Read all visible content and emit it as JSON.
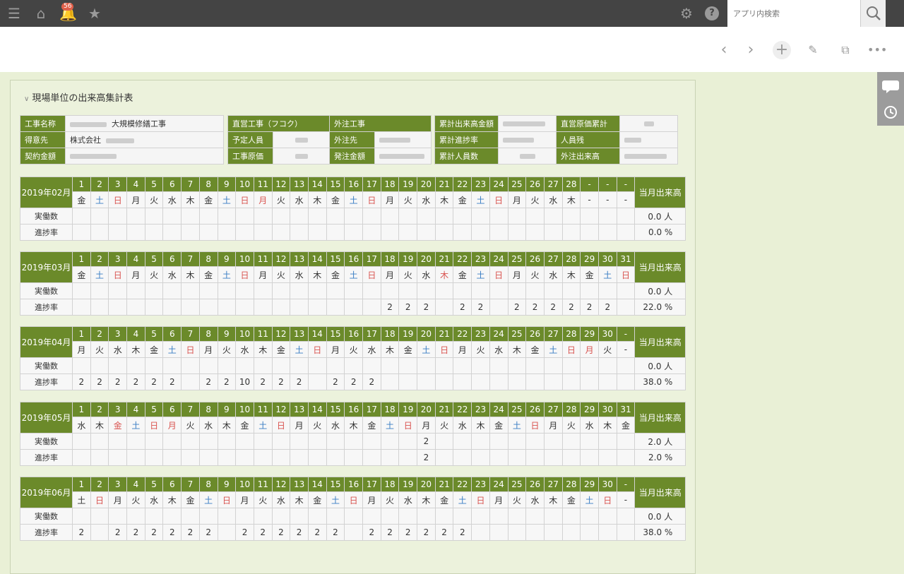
{
  "topbar": {
    "badge_count": "56",
    "search_placeholder": "アプリ内検索"
  },
  "section_title": "現場単位の出来高集計表",
  "info": {
    "block1": [
      {
        "label": "工事名称",
        "value": "大規模修繕工事",
        "blurred_prefix": true
      },
      {
        "label": "得意先",
        "value": "株式会社",
        "blurred_suffix": true
      },
      {
        "label": "契約金額",
        "value": "",
        "blurred": true
      }
    ],
    "block2": {
      "header_left": "直営工事（フコク）",
      "header_right": "外注工事",
      "rows": [
        {
          "l1": "予定人員",
          "l2": "外注先"
        },
        {
          "l1": "工事原価",
          "l2": "発注金額"
        }
      ]
    },
    "block3": [
      {
        "label": "累計出来高金額",
        "label2": "直営原価累計"
      },
      {
        "label": "累計進捗率",
        "label2": "人員残"
      },
      {
        "label": "累計人員数",
        "label2": "外注出来高"
      }
    ]
  },
  "calendar_labels": {
    "workers": "実働数",
    "progress": "進捗率",
    "monthly": "当月出来高"
  },
  "months": [
    {
      "name": "2019年02月",
      "days": [
        "1",
        "2",
        "3",
        "4",
        "5",
        "6",
        "7",
        "8",
        "9",
        "10",
        "11",
        "12",
        "13",
        "14",
        "15",
        "16",
        "17",
        "18",
        "19",
        "20",
        "21",
        "22",
        "23",
        "24",
        "25",
        "26",
        "27",
        "28",
        "-",
        "-",
        "-"
      ],
      "weekdays": [
        "金",
        "土",
        "日",
        "月",
        "火",
        "水",
        "木",
        "金",
        "土",
        "日",
        "月",
        "火",
        "水",
        "木",
        "金",
        "土",
        "日",
        "月",
        "火",
        "水",
        "木",
        "金",
        "土",
        "日",
        "月",
        "火",
        "水",
        "木",
        "-",
        "-",
        "-"
      ],
      "types": [
        "",
        "s",
        "u",
        "",
        "",
        "",
        "",
        "",
        "s",
        "u",
        "h",
        "",
        "",
        "",
        "",
        "s",
        "u",
        "",
        "",
        "",
        "",
        "",
        "s",
        "u",
        "",
        "",
        "",
        "",
        "",
        "",
        ""
      ],
      "workers": [
        "",
        "",
        "",
        "",
        "",
        "",
        "",
        "",
        "",
        "",
        "",
        "",
        "",
        "",
        "",
        "",
        "",
        "",
        "",
        "",
        "",
        "",
        "",
        "",
        "",
        "",
        "",
        "",
        "",
        "",
        ""
      ],
      "progress": [
        "",
        "",
        "",
        "",
        "",
        "",
        "",
        "",
        "",
        "",
        "",
        "",
        "",
        "",
        "",
        "",
        "",
        "",
        "",
        "",
        "",
        "",
        "",
        "",
        "",
        "",
        "",
        "",
        "",
        "",
        ""
      ],
      "workers_total": "0.0 人",
      "progress_total": "0.0 %"
    },
    {
      "name": "2019年03月",
      "days": [
        "1",
        "2",
        "3",
        "4",
        "5",
        "6",
        "7",
        "8",
        "9",
        "10",
        "11",
        "12",
        "13",
        "14",
        "15",
        "16",
        "17",
        "18",
        "19",
        "20",
        "21",
        "22",
        "23",
        "24",
        "25",
        "26",
        "27",
        "28",
        "29",
        "30",
        "31"
      ],
      "weekdays": [
        "金",
        "土",
        "日",
        "月",
        "火",
        "水",
        "木",
        "金",
        "土",
        "日",
        "月",
        "火",
        "水",
        "木",
        "金",
        "土",
        "日",
        "月",
        "火",
        "水",
        "木",
        "金",
        "土",
        "日",
        "月",
        "火",
        "水",
        "木",
        "金",
        "土",
        "日"
      ],
      "types": [
        "",
        "s",
        "u",
        "",
        "",
        "",
        "",
        "",
        "s",
        "u",
        "",
        "",
        "",
        "",
        "",
        "s",
        "u",
        "",
        "",
        "",
        "h",
        "",
        "s",
        "u",
        "",
        "",
        "",
        "",
        "",
        "s",
        "u"
      ],
      "workers": [
        "",
        "",
        "",
        "",
        "",
        "",
        "",
        "",
        "",
        "",
        "",
        "",
        "",
        "",
        "",
        "",
        "",
        "",
        "",
        "",
        "",
        "",
        "",
        "",
        "",
        "",
        "",
        "",
        "",
        "",
        ""
      ],
      "progress": [
        "",
        "",
        "",
        "",
        "",
        "",
        "",
        "",
        "",
        "",
        "",
        "",
        "",
        "",
        "",
        "",
        "",
        "2",
        "2",
        "2",
        "",
        "2",
        "2",
        "",
        "2",
        "2",
        "2",
        "2",
        "2",
        "2",
        ""
      ],
      "workers_total": "0.0 人",
      "progress_total": "22.0 %"
    },
    {
      "name": "2019年04月",
      "days": [
        "1",
        "2",
        "3",
        "4",
        "5",
        "6",
        "7",
        "8",
        "9",
        "10",
        "11",
        "12",
        "13",
        "14",
        "15",
        "16",
        "17",
        "18",
        "19",
        "20",
        "21",
        "22",
        "23",
        "24",
        "25",
        "26",
        "27",
        "28",
        "29",
        "30",
        "-"
      ],
      "weekdays": [
        "月",
        "火",
        "水",
        "木",
        "金",
        "土",
        "日",
        "月",
        "火",
        "水",
        "木",
        "金",
        "土",
        "日",
        "月",
        "火",
        "水",
        "木",
        "金",
        "土",
        "日",
        "月",
        "火",
        "水",
        "木",
        "金",
        "土",
        "日",
        "月",
        "火",
        "-"
      ],
      "types": [
        "",
        "",
        "",
        "",
        "",
        "s",
        "u",
        "",
        "",
        "",
        "",
        "",
        "s",
        "u",
        "",
        "",
        "",
        "",
        "",
        "s",
        "u",
        "",
        "",
        "",
        "",
        "",
        "s",
        "u",
        "h",
        "",
        ""
      ],
      "workers": [
        "",
        "",
        "",
        "",
        "",
        "",
        "",
        "",
        "",
        "",
        "",
        "",
        "",
        "",
        "",
        "",
        "",
        "",
        "",
        "",
        "",
        "",
        "",
        "",
        "",
        "",
        "",
        "",
        "",
        "",
        ""
      ],
      "progress": [
        "2",
        "2",
        "2",
        "2",
        "2",
        "2",
        "",
        "2",
        "2",
        "10",
        "2",
        "2",
        "2",
        "",
        "2",
        "2",
        "2",
        "",
        "",
        "",
        "",
        "",
        "",
        "",
        "",
        "",
        "",
        "",
        "",
        "",
        ""
      ],
      "workers_total": "0.0 人",
      "progress_total": "38.0 %"
    },
    {
      "name": "2019年05月",
      "days": [
        "1",
        "2",
        "3",
        "4",
        "5",
        "6",
        "7",
        "8",
        "9",
        "10",
        "11",
        "12",
        "13",
        "14",
        "15",
        "16",
        "17",
        "18",
        "19",
        "20",
        "21",
        "22",
        "23",
        "24",
        "25",
        "26",
        "27",
        "28",
        "29",
        "30",
        "31"
      ],
      "weekdays": [
        "水",
        "木",
        "金",
        "土",
        "日",
        "月",
        "火",
        "水",
        "木",
        "金",
        "土",
        "日",
        "月",
        "火",
        "水",
        "木",
        "金",
        "土",
        "日",
        "月",
        "火",
        "水",
        "木",
        "金",
        "土",
        "日",
        "月",
        "火",
        "水",
        "木",
        "金"
      ],
      "types": [
        "",
        "",
        "h",
        "s",
        "u",
        "h",
        "",
        "",
        "",
        "",
        "s",
        "u",
        "",
        "",
        "",
        "",
        "",
        "s",
        "u",
        "",
        "",
        "",
        "",
        "",
        "s",
        "u",
        "",
        "",
        "",
        "",
        ""
      ],
      "workers": [
        "",
        "",
        "",
        "",
        "",
        "",
        "",
        "",
        "",
        "",
        "",
        "",
        "",
        "",
        "",
        "",
        "",
        "",
        "",
        "2",
        "",
        "",
        "",
        "",
        "",
        "",
        "",
        "",
        "",
        "",
        ""
      ],
      "progress": [
        "",
        "",
        "",
        "",
        "",
        "",
        "",
        "",
        "",
        "",
        "",
        "",
        "",
        "",
        "",
        "",
        "",
        "",
        "",
        "2",
        "",
        "",
        "",
        "",
        "",
        "",
        "",
        "",
        "",
        "",
        ""
      ],
      "workers_total": "2.0 人",
      "progress_total": "2.0 %"
    },
    {
      "name": "2019年06月",
      "days": [
        "1",
        "2",
        "3",
        "4",
        "5",
        "6",
        "7",
        "8",
        "9",
        "10",
        "11",
        "12",
        "13",
        "14",
        "15",
        "16",
        "17",
        "18",
        "19",
        "20",
        "21",
        "22",
        "23",
        "24",
        "25",
        "26",
        "27",
        "28",
        "29",
        "30",
        "-"
      ],
      "weekdays": [
        "土",
        "日",
        "月",
        "火",
        "水",
        "木",
        "金",
        "土",
        "日",
        "月",
        "火",
        "水",
        "木",
        "金",
        "土",
        "日",
        "月",
        "火",
        "水",
        "木",
        "金",
        "土",
        "日",
        "月",
        "火",
        "水",
        "木",
        "金",
        "土",
        "日",
        "-"
      ],
      "types": [
        "",
        "u",
        "",
        "",
        "",
        "",
        "",
        "s",
        "u",
        "",
        "",
        "",
        "",
        "",
        "s",
        "u",
        "",
        "",
        "",
        "",
        "",
        "s",
        "u",
        "",
        "",
        "",
        "",
        "",
        "s",
        "u",
        ""
      ],
      "workers": [
        "",
        "",
        "",
        "",
        "",
        "",
        "",
        "",
        "",
        "",
        "",
        "",
        "",
        "",
        "",
        "",
        "",
        "",
        "",
        "",
        "",
        "",
        "",
        "",
        "",
        "",
        "",
        "",
        "",
        "",
        ""
      ],
      "progress": [
        "2",
        "",
        "2",
        "2",
        "2",
        "2",
        "2",
        "2",
        "",
        "2",
        "2",
        "2",
        "2",
        "2",
        "2",
        "",
        "2",
        "2",
        "2",
        "2",
        "2",
        "2",
        "",
        "",
        "",
        "",
        "",
        "",
        "",
        "",
        ""
      ],
      "workers_total": "0.0 人",
      "progress_total": "38.0 %"
    }
  ]
}
